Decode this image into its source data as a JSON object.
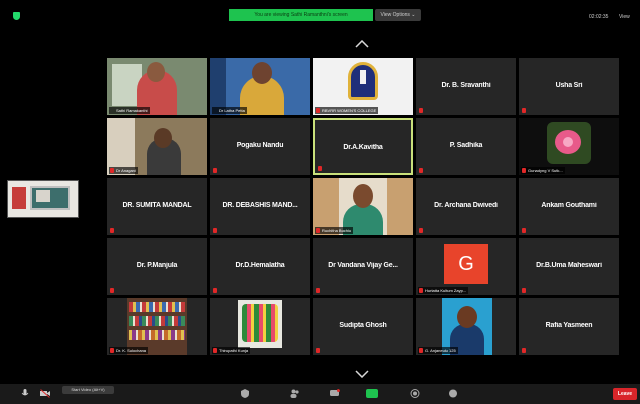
{
  "banner": {
    "viewing_text": "You are viewing Sathi Ramanthni's screen",
    "view_options": "View Options ⌄"
  },
  "status": {
    "clock": "02:02:35",
    "view_mode": "View"
  },
  "self_view": {
    "present": true
  },
  "tiles": [
    {
      "id": "t1",
      "caption": "Sathi Ramakanthi",
      "type": "video",
      "muted": false
    },
    {
      "id": "t2",
      "caption": "Dr Latha Petta",
      "type": "video",
      "muted": false
    },
    {
      "id": "t3",
      "caption": "RBVRR WOMEN'S COLLEGE",
      "type": "video",
      "muted": true
    },
    {
      "id": "t4",
      "name": "Dr. B. Sravanthi",
      "type": "name",
      "muted": true
    },
    {
      "id": "t5",
      "name": "Usha Sri",
      "type": "name",
      "muted": true
    },
    {
      "id": "t6",
      "caption": "Dr Anagani",
      "type": "video",
      "muted": true
    },
    {
      "id": "t7",
      "name": "Pogaku Nandu",
      "type": "name",
      "muted": true
    },
    {
      "id": "t8",
      "name": "Dr.A.Kavitha",
      "type": "name",
      "muted": true,
      "active": true
    },
    {
      "id": "t9",
      "name": "P. Sadhika",
      "type": "name",
      "muted": true
    },
    {
      "id": "t10",
      "caption": "Gunadyng V Sutk...",
      "type": "video",
      "muted": true
    },
    {
      "id": "t11",
      "name": "DR. SUMITA MANDAL",
      "type": "name",
      "muted": true
    },
    {
      "id": "t12",
      "name": "DR. DEBASHIS MAND...",
      "type": "name",
      "muted": true
    },
    {
      "id": "t13",
      "caption": "Ruchitha Buchiu",
      "type": "video",
      "muted": true
    },
    {
      "id": "t14",
      "name": "Dr. Archana Dwivedi",
      "type": "name",
      "muted": true
    },
    {
      "id": "t15",
      "name": "Ankam Gouthami",
      "type": "name",
      "muted": true
    },
    {
      "id": "t16",
      "name": "Dr. P.Manjula",
      "type": "name",
      "muted": true
    },
    {
      "id": "t17",
      "name": "Dr.D.Hemalatha",
      "type": "name",
      "muted": true
    },
    {
      "id": "t18",
      "name": "Dr Vandana Vijay Ge...",
      "type": "name",
      "muted": true
    },
    {
      "id": "t19",
      "caption": "Hurtatta Kultum Zayp...",
      "type": "avatar",
      "avatar_letter": "G",
      "muted": true
    },
    {
      "id": "t20",
      "name": "Dr.B.Uma Maheswari",
      "type": "name",
      "muted": true
    },
    {
      "id": "t21",
      "caption": "Dr. K. Sulochana",
      "type": "video",
      "muted": true
    },
    {
      "id": "t22",
      "caption": "Thirupathi Kunja",
      "type": "video",
      "muted": true
    },
    {
      "id": "t23",
      "name": "Sudipta Ghosh",
      "type": "name",
      "muted": true
    },
    {
      "id": "t24",
      "caption": "G. Anjaneulu 125",
      "type": "video",
      "muted": true
    },
    {
      "id": "t25",
      "name": "Rafia Yasmeen",
      "type": "name",
      "muted": true
    }
  ],
  "toolbar": {
    "start_video_tip": "Start Video (Alt+V)",
    "leave": "Leave"
  },
  "colors": {
    "tile_bg": "#262626",
    "active_border": "#c9e07a",
    "banner_green": "#1ec34f",
    "leave_red": "#d9252a",
    "avatar_red": "#e8442b"
  }
}
